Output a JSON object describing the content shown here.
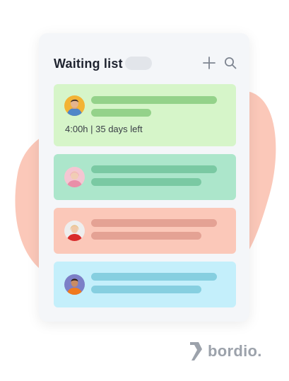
{
  "colors": {
    "blob": "#fbc8b9",
    "panel_bg": "#f4f6f9",
    "title_text": "#1f2430",
    "icon_color": "#7e8591",
    "logo_gray": "#9ca2ab",
    "card_green": "#d6f5c9",
    "card_teal": "#ace6cb",
    "card_salmon": "#fbc8b9",
    "card_blue": "#c4effb"
  },
  "panel": {
    "title": "Waiting list",
    "add_icon": "plus-icon",
    "search_icon": "search-icon"
  },
  "tasks": [
    {
      "avatar": "avatar-man-yellow-shirt",
      "time_text": "4:00h | 35 days left"
    },
    {
      "avatar": "avatar-woman-pink-hair"
    },
    {
      "avatar": "avatar-woman-red-top"
    },
    {
      "avatar": "avatar-man-orange-shirt"
    }
  ],
  "brand": {
    "logo_text": "bordio."
  }
}
